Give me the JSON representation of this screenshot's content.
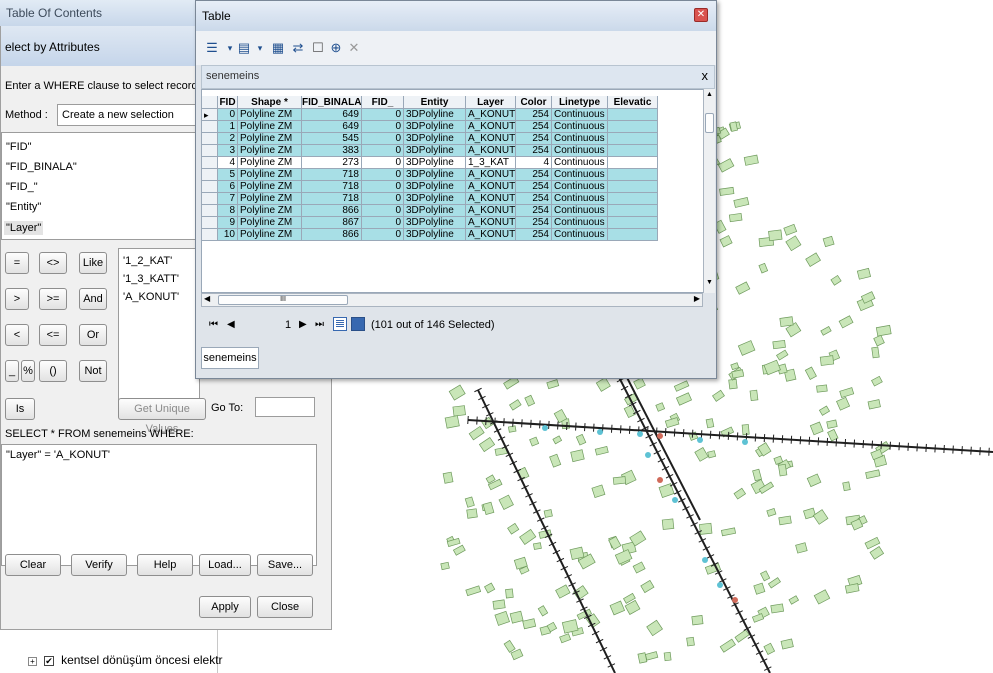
{
  "toc": {
    "title": "Table Of Contents",
    "layer_label": "kentsel dönüşüm öncesi elektr",
    "layer_checked": true
  },
  "select_dialog": {
    "title": "elect by Attributes",
    "instruction": "Enter a WHERE clause to select records in th",
    "method_label": "Method :",
    "method_value": "Create a new selection",
    "fields": [
      "\"FID\"",
      "\"FID_BINALA\"",
      "\"FID_\"",
      "\"Entity\"",
      "\"Layer\""
    ],
    "operators": [
      "=",
      "<>",
      "Like",
      ">",
      ">=",
      "And",
      "<",
      "<=",
      "Or",
      "_",
      "%",
      "()",
      "Not",
      "Is"
    ],
    "values": [
      "'1_2_KAT'",
      "'1_3_KATT'",
      "'A_KONUT'"
    ],
    "get_unique_label": "Get Unique Values",
    "goto_label": "Go To:",
    "select_from": "SELECT * FROM senemeins WHERE:",
    "expression": "\"Layer\" = 'A_KONUT'",
    "buttons": {
      "clear": "Clear",
      "verify": "Verify",
      "help": "Help",
      "load": "Load...",
      "save": "Save...",
      "apply": "Apply",
      "close": "Close"
    }
  },
  "table_window": {
    "title": "Table",
    "tab_name": "senemeins",
    "close_label": "x",
    "columns": [
      "FID",
      "Shape *",
      "FID_BINALA",
      "FID_",
      "Entity",
      "Layer",
      "Color",
      "Linetype",
      "Elevatic"
    ],
    "rows": [
      [
        "0",
        "Polyline ZM",
        "649",
        "0",
        "3DPolyline",
        "A_KONUT",
        "254",
        "Continuous",
        ""
      ],
      [
        "1",
        "Polyline ZM",
        "649",
        "0",
        "3DPolyline",
        "A_KONUT",
        "254",
        "Continuous",
        ""
      ],
      [
        "2",
        "Polyline ZM",
        "545",
        "0",
        "3DPolyline",
        "A_KONUT",
        "254",
        "Continuous",
        ""
      ],
      [
        "3",
        "Polyline ZM",
        "383",
        "0",
        "3DPolyline",
        "A_KONUT",
        "254",
        "Continuous",
        ""
      ],
      [
        "4",
        "Polyline ZM",
        "273",
        "0",
        "3DPolyline",
        "1_3_KAT",
        "4",
        "Continuous",
        ""
      ],
      [
        "5",
        "Polyline ZM",
        "718",
        "0",
        "3DPolyline",
        "A_KONUT",
        "254",
        "Continuous",
        ""
      ],
      [
        "6",
        "Polyline ZM",
        "718",
        "0",
        "3DPolyline",
        "A_KONUT",
        "254",
        "Continuous",
        ""
      ],
      [
        "7",
        "Polyline ZM",
        "718",
        "0",
        "3DPolyline",
        "A_KONUT",
        "254",
        "Continuous",
        ""
      ],
      [
        "8",
        "Polyline ZM",
        "866",
        "0",
        "3DPolyline",
        "A_KONUT",
        "254",
        "Continuous",
        ""
      ],
      [
        "9",
        "Polyline ZM",
        "867",
        "0",
        "3DPolyline",
        "A_KONUT",
        "254",
        "Continuous",
        ""
      ],
      [
        "10",
        "Polyline ZM",
        "866",
        "0",
        "3DPolyline",
        "A_KONUT",
        "254",
        "Continuous",
        ""
      ]
    ],
    "selected_rows": [
      0,
      1,
      2,
      3,
      5,
      6,
      7,
      8,
      9,
      10
    ],
    "current_record": "1",
    "status": "(101 out of 146 Selected)",
    "scroll_glyph": "III",
    "bottom_tab": "senemeins"
  },
  "colors": {
    "selected_row": "#a8dfe6",
    "map_building": "#c9e6b8",
    "map_building_edge": "#6e9a5c",
    "map_line": "#1f1f1f",
    "map_highlight_blue": "#5ec2d4",
    "map_highlight_red": "#d06a5a"
  }
}
